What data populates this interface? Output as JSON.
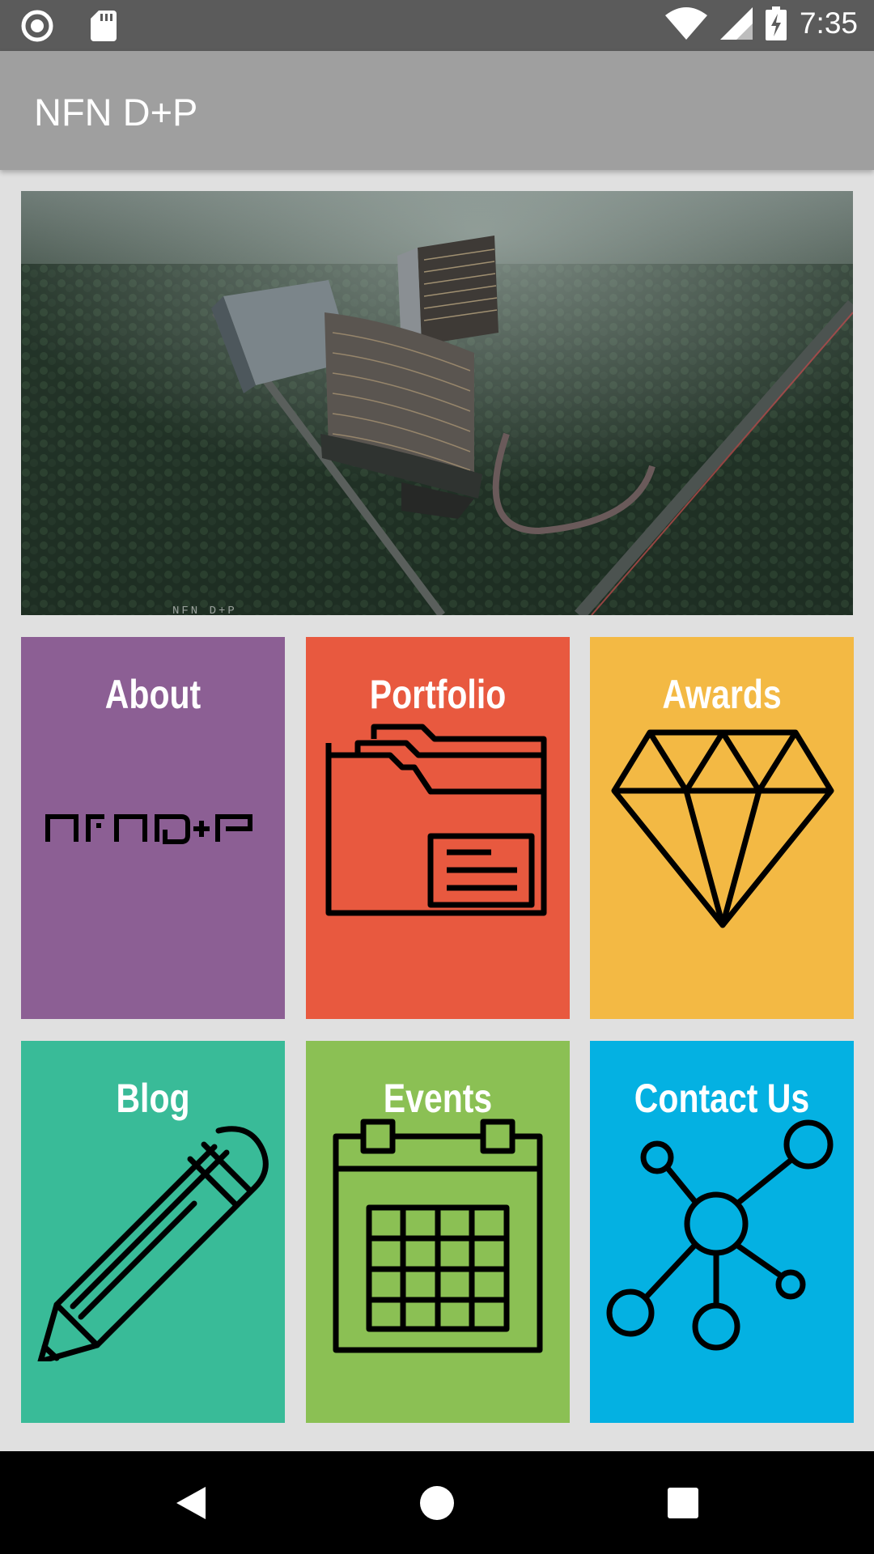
{
  "status_bar": {
    "time": "7:35",
    "icons": [
      "record-icon",
      "sd-card-icon",
      "wifi-icon",
      "signal-icon",
      "battery-charging-icon"
    ]
  },
  "app_bar": {
    "title": "NFN D+P"
  },
  "hero": {
    "image": "aerial-architecture-rendering",
    "watermark": "NFN D+P"
  },
  "tiles": [
    {
      "label": "About",
      "color": "#8c5f94",
      "icon": "nfn-dp-logo"
    },
    {
      "label": "Portfolio",
      "color": "#e8593f",
      "icon": "folder-icon"
    },
    {
      "label": "Awards",
      "color": "#f3b944",
      "icon": "diamond-icon"
    },
    {
      "label": "Blog",
      "color": "#39bb98",
      "icon": "pencil-icon"
    },
    {
      "label": "Events",
      "color": "#8bc054",
      "icon": "calendar-icon"
    },
    {
      "label": "Contact Us",
      "color": "#04b1e2",
      "icon": "network-icon"
    }
  ],
  "nav_bar": {
    "buttons": [
      "back-icon",
      "home-icon",
      "recents-icon"
    ]
  }
}
